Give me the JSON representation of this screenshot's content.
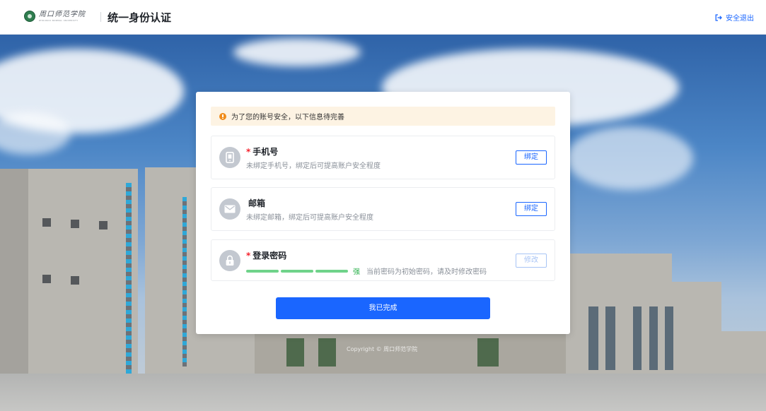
{
  "header": {
    "logo_cn": "周口师范学院",
    "logo_en": "ZHOUKOU NORMAL UNIVERSITY",
    "title": "统一身份认证",
    "logout_label": "安全退出"
  },
  "alert": {
    "text": "为了您的账号安全，以下信息待完善"
  },
  "items": [
    {
      "required": "*",
      "title": "手机号",
      "desc": "未绑定手机号，绑定后可提高账户安全程度",
      "button": "绑定",
      "icon": "phone-icon"
    },
    {
      "required": "",
      "title": "邮箱",
      "desc": "未绑定邮箱，绑定后可提高账户安全程度",
      "button": "绑定",
      "icon": "mail-icon"
    },
    {
      "required": "*",
      "title": "登录密码",
      "strength_label": "强",
      "strength_level": 1.0,
      "note": "当前密码为初始密码，请及时修改密码",
      "button": "修改",
      "icon": "lock-icon"
    }
  ],
  "done_button": "我已完成",
  "copyright": "Copyright © 周口师范学院",
  "colors": {
    "primary": "#1a66ff",
    "warning": "#f08c1a",
    "required": "#f5222d",
    "strength": "#6fd38a"
  }
}
